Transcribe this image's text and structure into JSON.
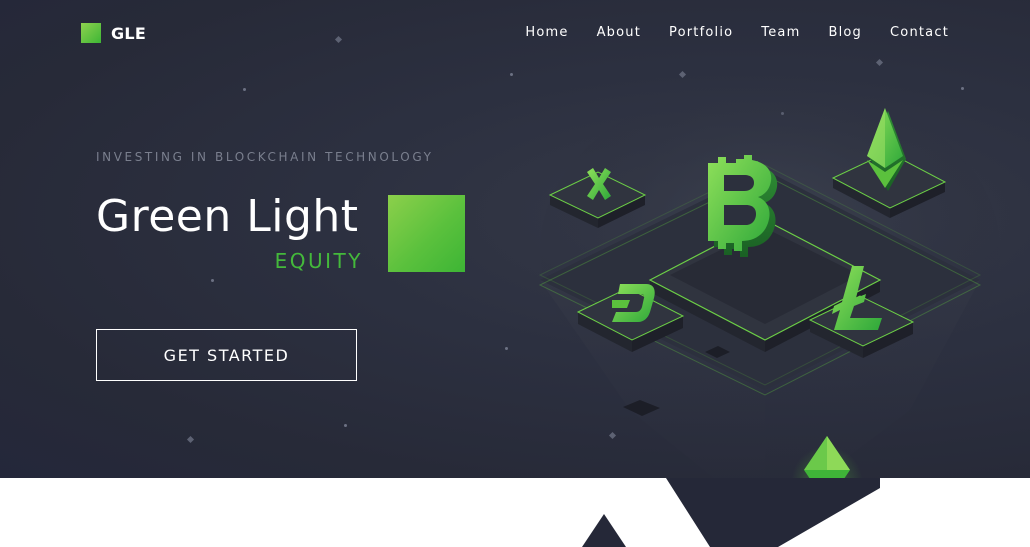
{
  "brand": {
    "name": "GLE"
  },
  "nav": {
    "items": [
      {
        "label": "Home"
      },
      {
        "label": "About"
      },
      {
        "label": "Portfolio"
      },
      {
        "label": "Team"
      },
      {
        "label": "Blog"
      },
      {
        "label": "Contact"
      }
    ]
  },
  "hero": {
    "tagline": "INVESTING IN BLOCKCHAIN TECHNOLOGY",
    "title": "Green Light",
    "subtitle": "EQUITY",
    "cta_label": "GET STARTED"
  },
  "colors": {
    "background": "#2a2d3c",
    "accent_green": "#44b93b",
    "light_green": "#8fd14f",
    "text": "#ffffff",
    "muted": "#7a7f8e"
  },
  "illustration": {
    "icons": [
      "bitcoin-icon",
      "ethereum-icon",
      "litecoin-icon",
      "dash-icon",
      "ripple-icon"
    ]
  }
}
